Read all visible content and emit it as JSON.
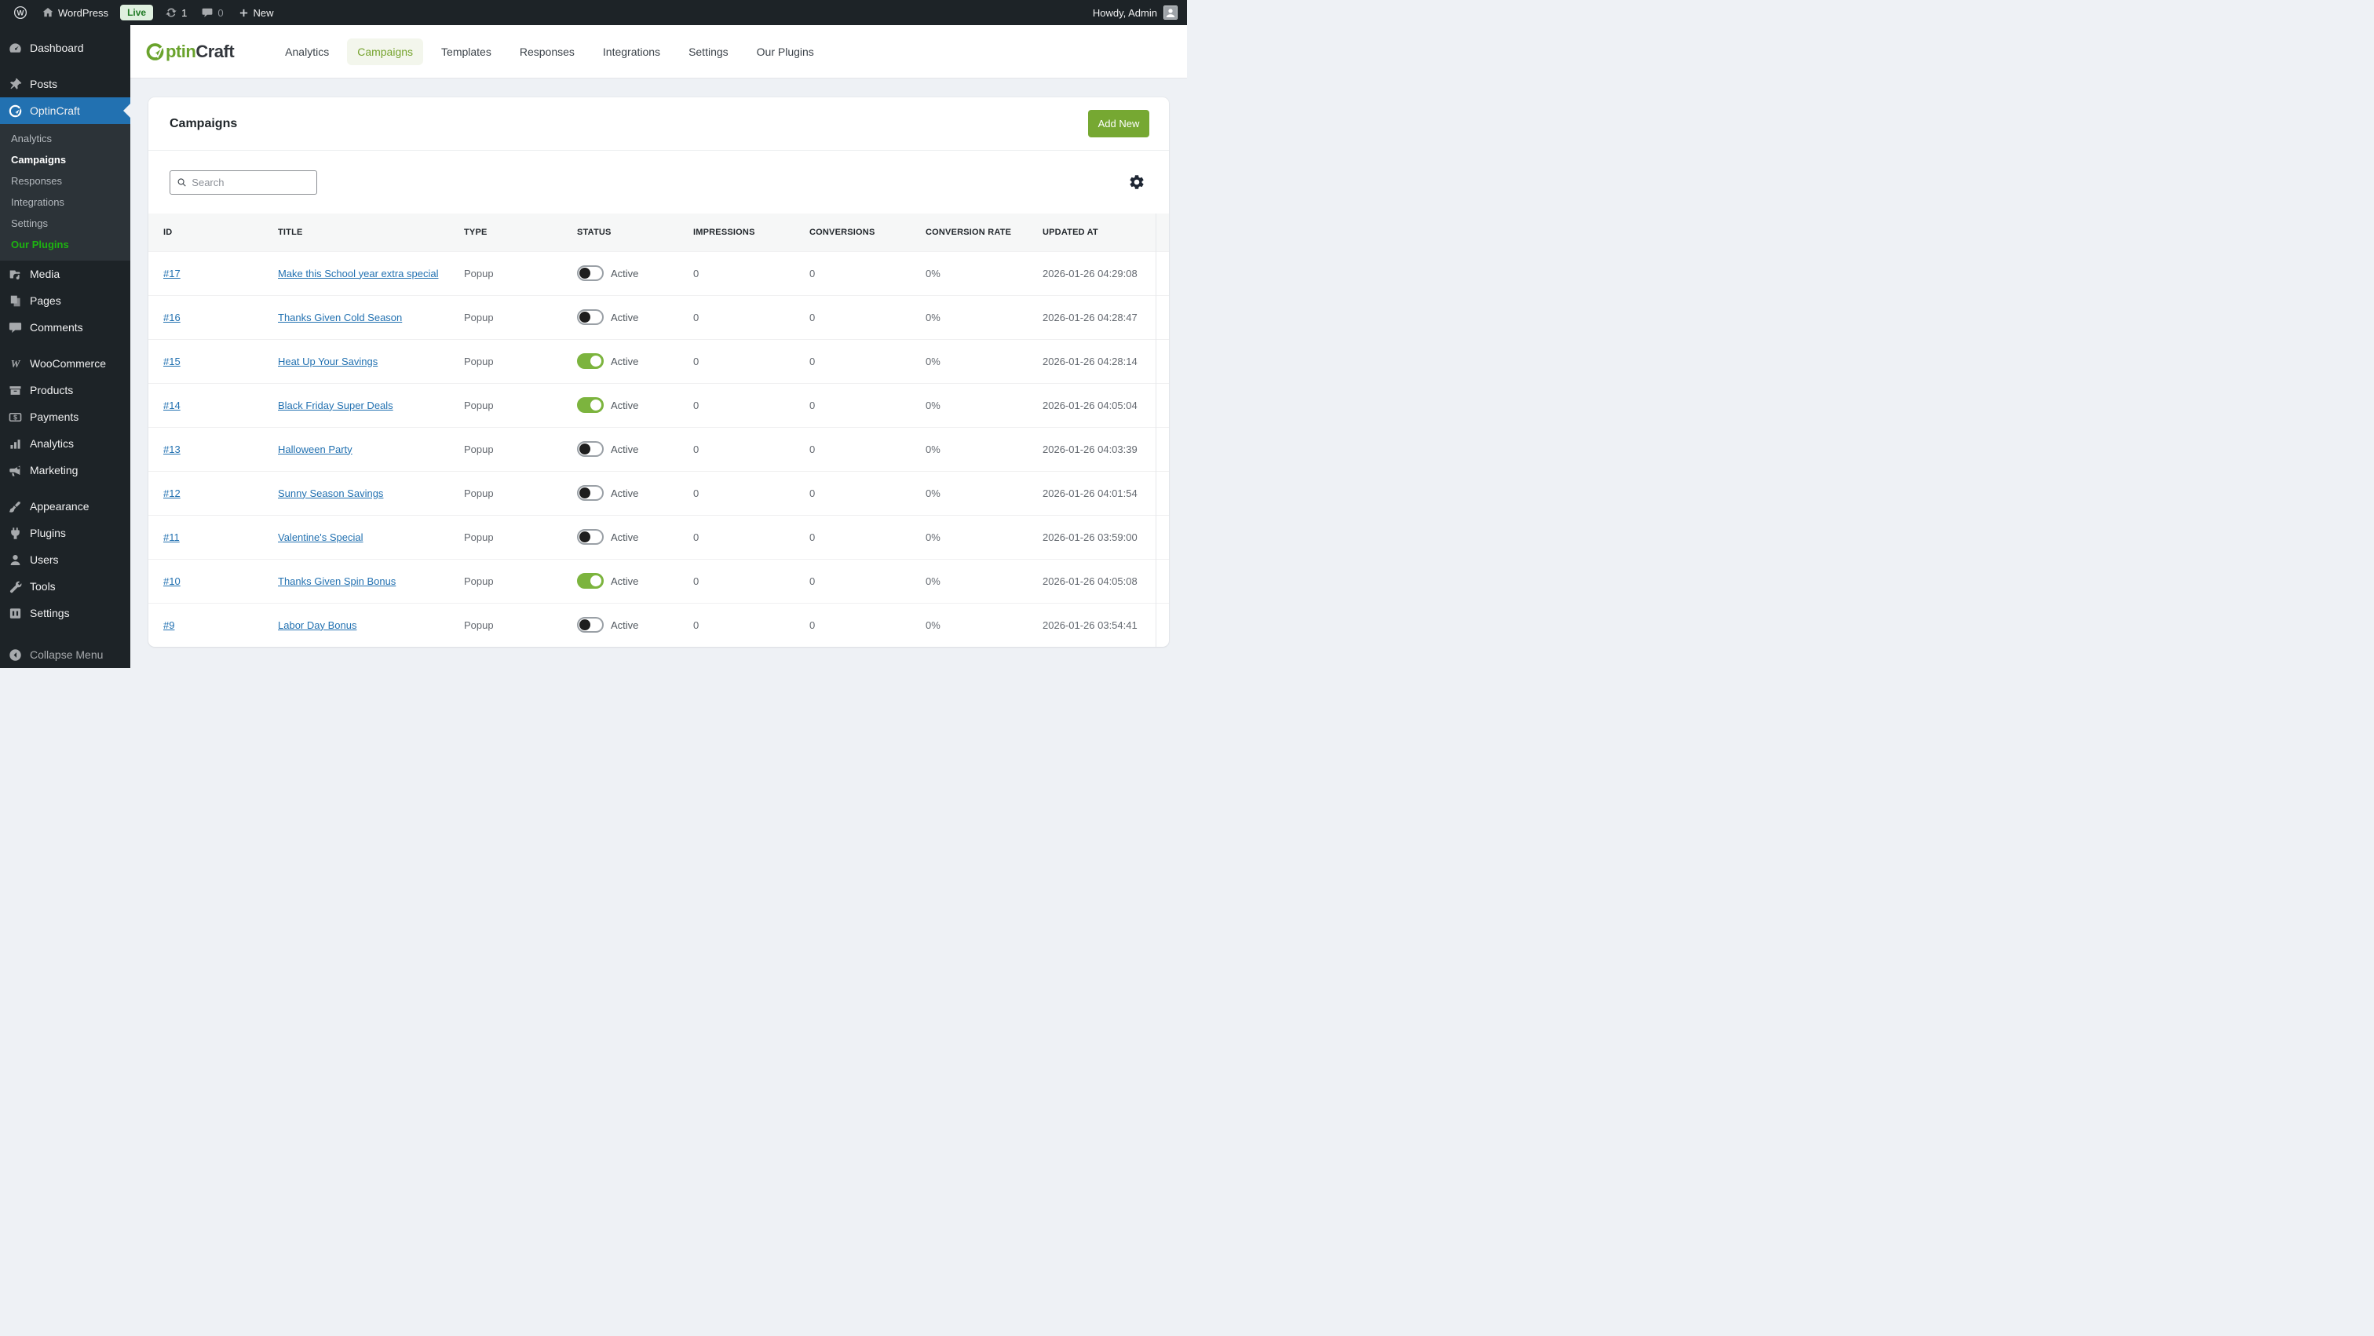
{
  "admin_bar": {
    "wordpress_label": "WordPress",
    "environment_badge": "Live",
    "updates_count": "1",
    "comments_count": "0",
    "new_label": "New",
    "howdy_text": "Howdy, Admin"
  },
  "sidebar": {
    "items": [
      {
        "label": "Dashboard",
        "icon": "dashboard"
      },
      {
        "label": "Posts",
        "icon": "pushpin"
      },
      {
        "label": "OptinCraft",
        "icon": "optincraft",
        "active": true,
        "submenu": [
          {
            "label": "Analytics"
          },
          {
            "label": "Campaigns",
            "current": true
          },
          {
            "label": "Responses"
          },
          {
            "label": "Integrations"
          },
          {
            "label": "Settings"
          },
          {
            "label": "Our Plugins",
            "highlight": true
          }
        ]
      },
      {
        "label": "Media",
        "icon": "media"
      },
      {
        "label": "Pages",
        "icon": "pages"
      },
      {
        "label": "Comments",
        "icon": "comments"
      },
      {
        "separator": true
      },
      {
        "label": "WooCommerce",
        "icon": "woocommerce"
      },
      {
        "label": "Products",
        "icon": "products"
      },
      {
        "label": "Payments",
        "icon": "payments"
      },
      {
        "label": "Analytics",
        "icon": "analytics"
      },
      {
        "label": "Marketing",
        "icon": "marketing"
      },
      {
        "separator": true
      },
      {
        "label": "Appearance",
        "icon": "appearance"
      },
      {
        "label": "Plugins",
        "icon": "plugins"
      },
      {
        "label": "Users",
        "icon": "users"
      },
      {
        "label": "Tools",
        "icon": "tools"
      },
      {
        "label": "Settings",
        "icon": "settings"
      },
      {
        "label": "Collapse Menu",
        "icon": "collapse",
        "collapse": true
      }
    ]
  },
  "topnav": {
    "brand_green": "ptin",
    "brand_dark": "Craft",
    "tabs": [
      {
        "label": "Analytics"
      },
      {
        "label": "Campaigns",
        "active": true
      },
      {
        "label": "Templates"
      },
      {
        "label": "Responses"
      },
      {
        "label": "Integrations"
      },
      {
        "label": "Settings"
      },
      {
        "label": "Our Plugins"
      }
    ]
  },
  "page": {
    "title": "Campaigns",
    "add_new_label": "Add New",
    "search_placeholder": "Search"
  },
  "table": {
    "columns": [
      "ID",
      "TITLE",
      "TYPE",
      "STATUS",
      "IMPRESSIONS",
      "CONVERSIONS",
      "CONVERSION RATE",
      "UPDATED AT"
    ],
    "rows": [
      {
        "id": "#17",
        "title": "Make this School year extra special",
        "type": "Popup",
        "status_on": false,
        "status_label": "Active",
        "impressions": "0",
        "conversions": "0",
        "conversion_rate": "0%",
        "updated_at": "2026-01-26 04:29:08"
      },
      {
        "id": "#16",
        "title": "Thanks Given Cold Season",
        "type": "Popup",
        "status_on": false,
        "status_label": "Active",
        "impressions": "0",
        "conversions": "0",
        "conversion_rate": "0%",
        "updated_at": "2026-01-26 04:28:47"
      },
      {
        "id": "#15",
        "title": "Heat Up Your Savings",
        "type": "Popup",
        "status_on": true,
        "status_label": "Active",
        "impressions": "0",
        "conversions": "0",
        "conversion_rate": "0%",
        "updated_at": "2026-01-26 04:28:14"
      },
      {
        "id": "#14",
        "title": "Black Friday Super Deals",
        "type": "Popup",
        "status_on": true,
        "status_label": "Active",
        "impressions": "0",
        "conversions": "0",
        "conversion_rate": "0%",
        "updated_at": "2026-01-26 04:05:04"
      },
      {
        "id": "#13",
        "title": "Halloween Party",
        "type": "Popup",
        "status_on": false,
        "status_label": "Active",
        "impressions": "0",
        "conversions": "0",
        "conversion_rate": "0%",
        "updated_at": "2026-01-26 04:03:39"
      },
      {
        "id": "#12",
        "title": "Sunny Season Savings",
        "type": "Popup",
        "status_on": false,
        "status_label": "Active",
        "impressions": "0",
        "conversions": "0",
        "conversion_rate": "0%",
        "updated_at": "2026-01-26 04:01:54"
      },
      {
        "id": "#11",
        "title": "Valentine's Special",
        "type": "Popup",
        "status_on": false,
        "status_label": "Active",
        "impressions": "0",
        "conversions": "0",
        "conversion_rate": "0%",
        "updated_at": "2026-01-26 03:59:00"
      },
      {
        "id": "#10",
        "title": "Thanks Given Spin Bonus",
        "type": "Popup",
        "status_on": true,
        "status_label": "Active",
        "impressions": "0",
        "conversions": "0",
        "conversion_rate": "0%",
        "updated_at": "2026-01-26 04:05:08"
      },
      {
        "id": "#9",
        "title": "Labor Day Bonus",
        "type": "Popup",
        "status_on": false,
        "status_label": "Active",
        "impressions": "0",
        "conversions": "0",
        "conversion_rate": "0%",
        "updated_at": "2026-01-26 03:54:41"
      }
    ]
  },
  "colors": {
    "accent_green": "#76a832",
    "toggle_on_green": "#7cb43e",
    "link_blue": "#2271b1",
    "active_menu_blue": "#2271b1",
    "our_plugins_green": "#1db510",
    "live_badge_bg": "#dff0df",
    "live_badge_text": "#1f7a24",
    "admin_dark": "#1d2327",
    "submenu_dark": "#2c3338"
  }
}
